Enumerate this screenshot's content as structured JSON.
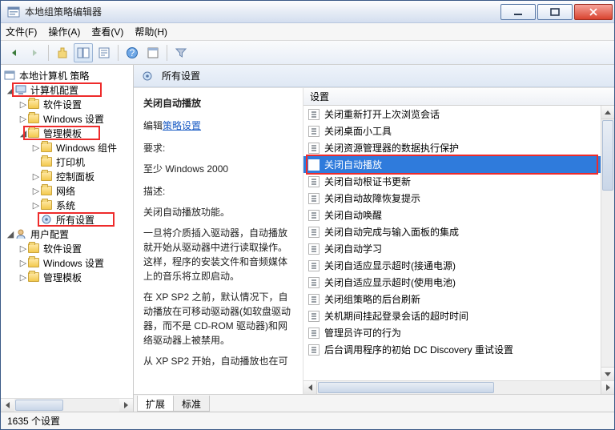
{
  "window": {
    "title": "本地组策略编辑器"
  },
  "menu": {
    "file": "文件(F)",
    "action": "操作(A)",
    "view": "查看(V)",
    "help": "帮助(H)"
  },
  "tree": {
    "root": "本地计算机 策略",
    "computer_config": "计算机配置",
    "software_settings": "软件设置",
    "windows_settings": "Windows 设置",
    "admin_templates": "管理模板",
    "windows_components": "Windows 组件",
    "printers": "打印机",
    "control_panel": "控制面板",
    "network": "网络",
    "system": "系统",
    "all_settings": "所有设置",
    "user_config": "用户配置",
    "u_software": "软件设置",
    "u_windows": "Windows 设置",
    "u_admin": "管理模板"
  },
  "header": {
    "title": "所有设置"
  },
  "detail": {
    "title": "关闭自动播放",
    "edit_prefix": "编辑",
    "edit_link": "策略设置",
    "req_label": "要求:",
    "req_value": "至少 Windows 2000",
    "desc_label": "描述:",
    "desc_1": "关闭自动播放功能。",
    "desc_2": "一旦将介质插入驱动器，自动播放就开始从驱动器中进行读取操作。这样，程序的安装文件和音频媒体上的音乐将立即启动。",
    "desc_3": "在 XP SP2 之前，默认情况下，自动播放在可移动驱动器(如软盘驱动器，而不是 CD-ROM 驱动器)和网络驱动器上被禁用。",
    "desc_4": "从 XP SP2 开始，自动播放也在可"
  },
  "list": {
    "column": "设置",
    "items": [
      "关闭重新打开上次浏览会话",
      "关闭桌面小工具",
      "关闭资源管理器的数据执行保护",
      "关闭自动播放",
      "关闭自动根证书更新",
      "关闭自动故障恢复提示",
      "关闭自动唤醒",
      "关闭自动完成与输入面板的集成",
      "关闭自动学习",
      "关闭自适应显示超时(接通电源)",
      "关闭自适应显示超时(使用电池)",
      "关闭组策略的后台刷新",
      "关机期间挂起登录会话的超时时间",
      "管理员许可的行为",
      "后台调用程序的初始 DC Discovery 重试设置"
    ],
    "selected_index": 3
  },
  "tabs": {
    "extended": "扩展",
    "standard": "标准"
  },
  "status": {
    "count": "1635 个设置"
  }
}
